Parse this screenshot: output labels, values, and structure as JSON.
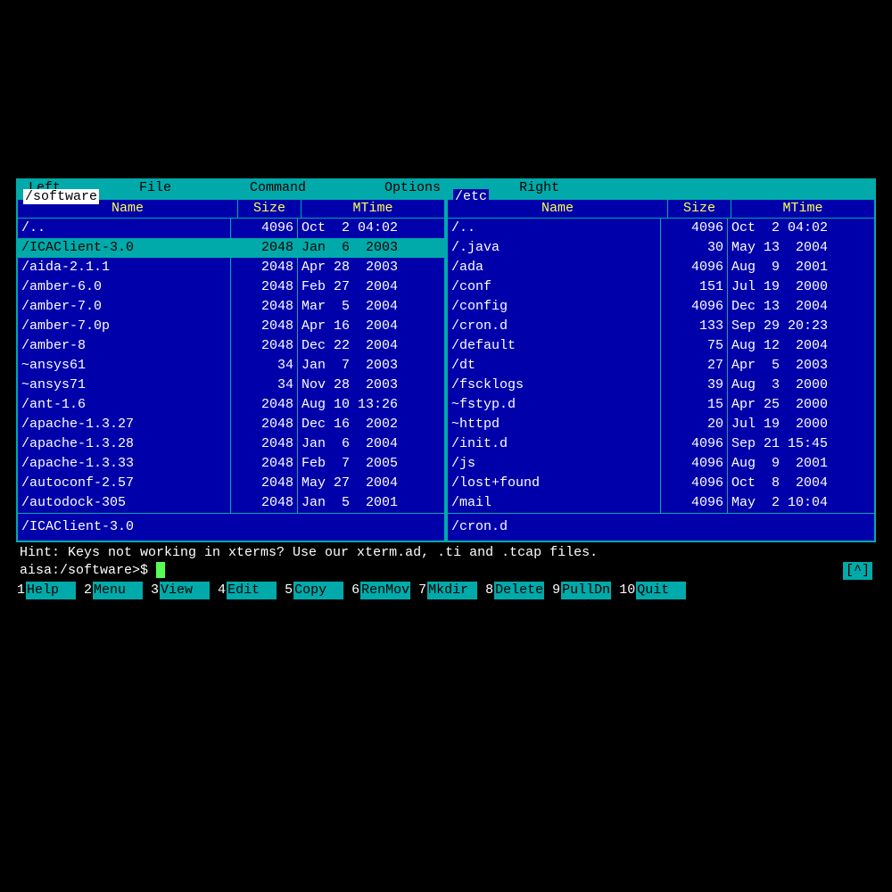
{
  "menu": {
    "left": "Left",
    "file": "File",
    "command": "Command",
    "options": "Options",
    "right": "Right"
  },
  "left_panel": {
    "title": "/software",
    "headers": {
      "name": "Name",
      "size": "Size",
      "mtime": "MTime"
    },
    "status": "/ICAClient-3.0",
    "files": [
      {
        "name": "/..",
        "size": "4096",
        "mtime": "Oct  2 04:02",
        "selected": false
      },
      {
        "name": "/ICAClient-3.0",
        "size": "2048",
        "mtime": "Jan  6  2003",
        "selected": true
      },
      {
        "name": "/aida-2.1.1",
        "size": "2048",
        "mtime": "Apr 28  2003",
        "selected": false
      },
      {
        "name": "/amber-6.0",
        "size": "2048",
        "mtime": "Feb 27  2004",
        "selected": false
      },
      {
        "name": "/amber-7.0",
        "size": "2048",
        "mtime": "Mar  5  2004",
        "selected": false
      },
      {
        "name": "/amber-7.0p",
        "size": "2048",
        "mtime": "Apr 16  2004",
        "selected": false
      },
      {
        "name": "/amber-8",
        "size": "2048",
        "mtime": "Dec 22  2004",
        "selected": false
      },
      {
        "name": "~ansys61",
        "size": "34",
        "mtime": "Jan  7  2003",
        "selected": false
      },
      {
        "name": "~ansys71",
        "size": "34",
        "mtime": "Nov 28  2003",
        "selected": false
      },
      {
        "name": "/ant-1.6",
        "size": "2048",
        "mtime": "Aug 10 13:26",
        "selected": false
      },
      {
        "name": "/apache-1.3.27",
        "size": "2048",
        "mtime": "Dec 16  2002",
        "selected": false
      },
      {
        "name": "/apache-1.3.28",
        "size": "2048",
        "mtime": "Jan  6  2004",
        "selected": false
      },
      {
        "name": "/apache-1.3.33",
        "size": "2048",
        "mtime": "Feb  7  2005",
        "selected": false
      },
      {
        "name": "/autoconf-2.57",
        "size": "2048",
        "mtime": "May 27  2004",
        "selected": false
      },
      {
        "name": "/autodock-305",
        "size": "2048",
        "mtime": "Jan  5  2001",
        "selected": false
      }
    ]
  },
  "right_panel": {
    "title": "/etc",
    "headers": {
      "name": "Name",
      "size": "Size",
      "mtime": "MTime"
    },
    "status": "/cron.d",
    "files": [
      {
        "name": "/..",
        "size": "4096",
        "mtime": "Oct  2 04:02",
        "selected": false
      },
      {
        "name": "/.java",
        "size": "30",
        "mtime": "May 13  2004",
        "selected": false
      },
      {
        "name": "/ada",
        "size": "4096",
        "mtime": "Aug  9  2001",
        "selected": false
      },
      {
        "name": "/conf",
        "size": "151",
        "mtime": "Jul 19  2000",
        "selected": false
      },
      {
        "name": "/config",
        "size": "4096",
        "mtime": "Dec 13  2004",
        "selected": false
      },
      {
        "name": "/cron.d",
        "size": "133",
        "mtime": "Sep 29 20:23",
        "selected": false
      },
      {
        "name": "/default",
        "size": "75",
        "mtime": "Aug 12  2004",
        "selected": false
      },
      {
        "name": "/dt",
        "size": "27",
        "mtime": "Apr  5  2003",
        "selected": false
      },
      {
        "name": "/fscklogs",
        "size": "39",
        "mtime": "Aug  3  2000",
        "selected": false
      },
      {
        "name": "~fstyp.d",
        "size": "15",
        "mtime": "Apr 25  2000",
        "selected": false
      },
      {
        "name": "~httpd",
        "size": "20",
        "mtime": "Jul 19  2000",
        "selected": false
      },
      {
        "name": "/init.d",
        "size": "4096",
        "mtime": "Sep 21 15:45",
        "selected": false
      },
      {
        "name": "/js",
        "size": "4096",
        "mtime": "Aug  9  2001",
        "selected": false
      },
      {
        "name": "/lost+found",
        "size": "4096",
        "mtime": "Oct  8  2004",
        "selected": false
      },
      {
        "name": "/mail",
        "size": "4096",
        "mtime": "May  2 10:04",
        "selected": false
      }
    ]
  },
  "hint": "Hint: Keys not working in xterms? Use our xterm.ad, .ti and .tcap files.",
  "prompt": "aisa:/software>$ ",
  "caret": "[^]",
  "fkeys": [
    {
      "num": "1",
      "label": "Help  "
    },
    {
      "num": "2",
      "label": "Menu  "
    },
    {
      "num": "3",
      "label": "View  "
    },
    {
      "num": "4",
      "label": "Edit  "
    },
    {
      "num": "5",
      "label": "Copy  "
    },
    {
      "num": "6",
      "label": "RenMov"
    },
    {
      "num": "7",
      "label": "Mkdir "
    },
    {
      "num": "8",
      "label": "Delete"
    },
    {
      "num": "9",
      "label": "PullDn"
    },
    {
      "num": "10",
      "label": "Quit  "
    }
  ]
}
